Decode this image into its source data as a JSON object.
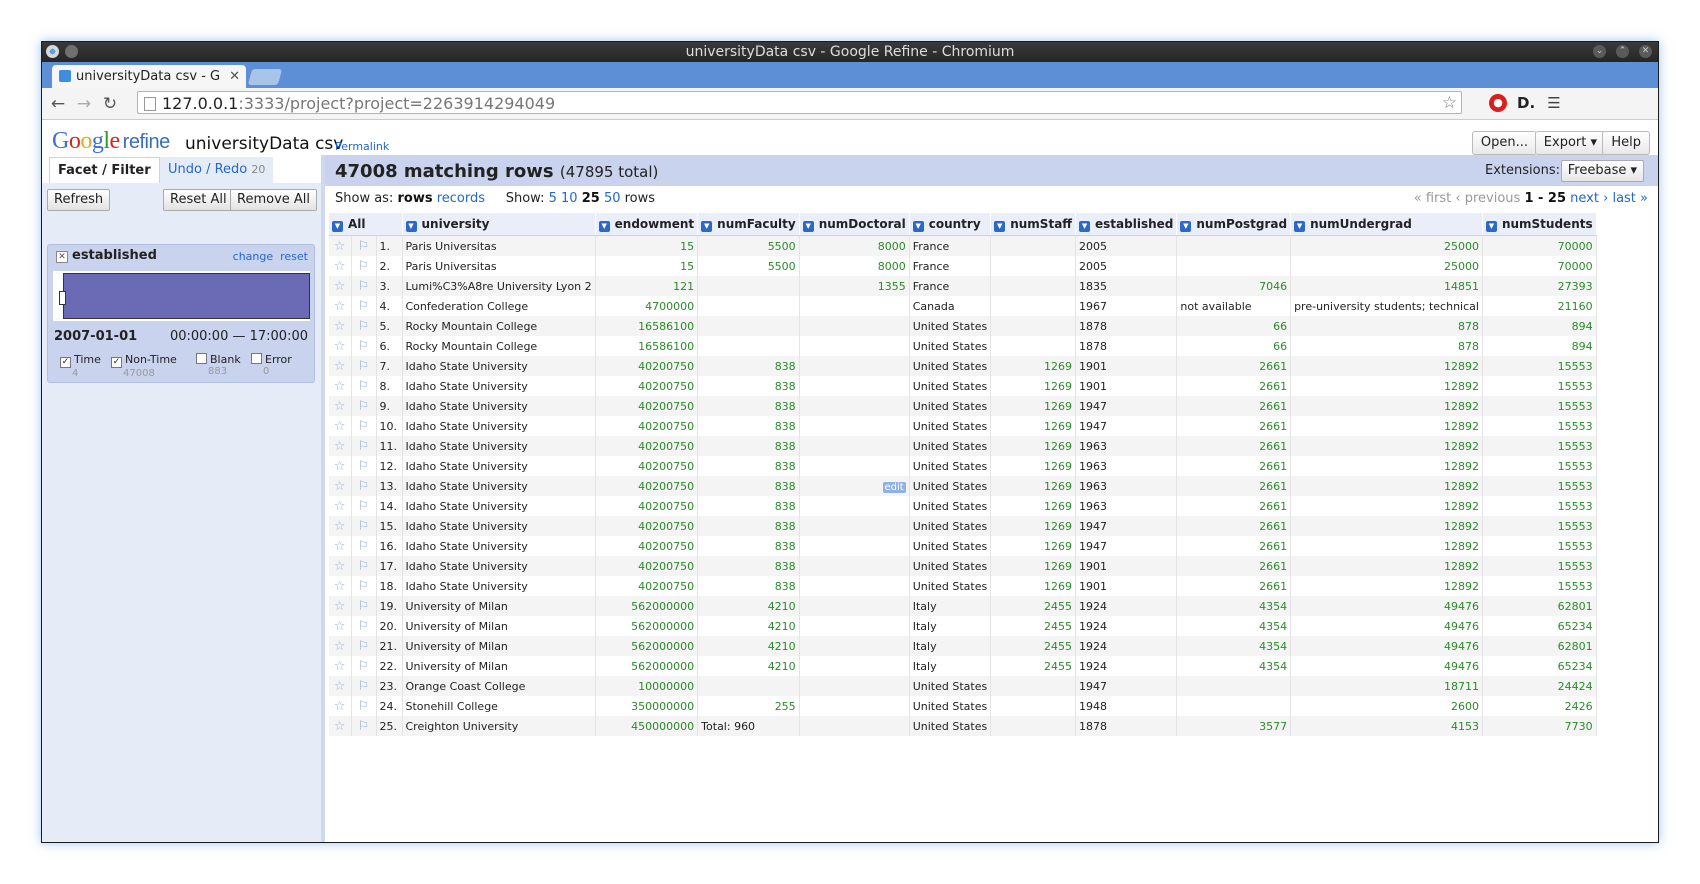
{
  "window": {
    "title": "universityData csv - Google Refine - Chromium"
  },
  "browser": {
    "tab_title": "universityData csv - G",
    "url_host": "127.0.0.1",
    "url_path": ":3333/project?project=2263914294049"
  },
  "header": {
    "logo_refine": "refine",
    "project_name": "universityData csv",
    "permalink": "Permalink",
    "open_label": "Open...",
    "export_label": "Export ▾",
    "help_label": "Help"
  },
  "leftpanel": {
    "tab_facet": "Facet / Filter",
    "tab_undo": "Undo / Redo",
    "undo_count": "20",
    "refresh": "Refresh",
    "reset_all": "Reset All",
    "remove_all": "Remove All",
    "facet": {
      "title": "established",
      "change": "change",
      "reset": "reset",
      "date": "2007-01-01",
      "time_range": "00:00:00 — 17:00:00",
      "checks": [
        {
          "label": "Time",
          "count": "4",
          "checked": true
        },
        {
          "label": "Non-Time",
          "count": "47008",
          "checked": true
        },
        {
          "label": "Blank",
          "count": "883",
          "checked": false
        },
        {
          "label": "Error",
          "count": "0",
          "checked": false
        }
      ]
    }
  },
  "summary": {
    "matching": "47008 matching rows",
    "total": "(47895 total)",
    "extensions_label": "Extensions:",
    "extensions_btn": "Freebase ▾"
  },
  "viewbar": {
    "show_as": "Show as:",
    "rows": "rows",
    "records": "records",
    "show": "Show:",
    "opt5": "5",
    "opt10": "10",
    "opt25": "25",
    "opt50": "50",
    "rows_suffix": "rows",
    "first": "« first",
    "previous": "‹ previous",
    "range": "1 - 25",
    "next": "next ›",
    "last": "last »"
  },
  "table": {
    "all_label": "All",
    "columns": [
      "university",
      "endowment",
      "numFaculty",
      "numDoctoral",
      "country",
      "numStaff",
      "established",
      "numPostgrad",
      "numUndergrad",
      "numStudents"
    ],
    "rows": [
      [
        "1.",
        "Paris Universitas",
        "15",
        "5500",
        "8000",
        "France",
        "",
        "2005",
        "",
        "25000",
        "70000"
      ],
      [
        "2.",
        "Paris Universitas",
        "15",
        "5500",
        "8000",
        "France",
        "",
        "2005",
        "",
        "25000",
        "70000"
      ],
      [
        "3.",
        "Lumi%C3%A8re University Lyon 2",
        "121",
        "",
        "1355",
        "France",
        "",
        "1835",
        "7046",
        "14851",
        "27393"
      ],
      [
        "4.",
        "Confederation College",
        "4700000",
        "",
        "",
        "Canada",
        "",
        "1967",
        "not available",
        "pre-university students; technical",
        "21160"
      ],
      [
        "5.",
        "Rocky Mountain College",
        "16586100",
        "",
        "",
        "United States",
        "",
        "1878",
        "66",
        "878",
        "894"
      ],
      [
        "6.",
        "Rocky Mountain College",
        "16586100",
        "",
        "",
        "United States",
        "",
        "1878",
        "66",
        "878",
        "894"
      ],
      [
        "7.",
        "Idaho State University",
        "40200750",
        "838",
        "",
        "United States",
        "1269",
        "1901",
        "2661",
        "12892",
        "15553"
      ],
      [
        "8.",
        "Idaho State University",
        "40200750",
        "838",
        "",
        "United States",
        "1269",
        "1901",
        "2661",
        "12892",
        "15553"
      ],
      [
        "9.",
        "Idaho State University",
        "40200750",
        "838",
        "",
        "United States",
        "1269",
        "1947",
        "2661",
        "12892",
        "15553"
      ],
      [
        "10.",
        "Idaho State University",
        "40200750",
        "838",
        "",
        "United States",
        "1269",
        "1947",
        "2661",
        "12892",
        "15553"
      ],
      [
        "11.",
        "Idaho State University",
        "40200750",
        "838",
        "",
        "United States",
        "1269",
        "1963",
        "2661",
        "12892",
        "15553"
      ],
      [
        "12.",
        "Idaho State University",
        "40200750",
        "838",
        "",
        "United States",
        "1269",
        "1963",
        "2661",
        "12892",
        "15553"
      ],
      [
        "13.",
        "Idaho State University",
        "40200750",
        "838",
        "edit",
        "United States",
        "1269",
        "1963",
        "2661",
        "12892",
        "15553"
      ],
      [
        "14.",
        "Idaho State University",
        "40200750",
        "838",
        "",
        "United States",
        "1269",
        "1963",
        "2661",
        "12892",
        "15553"
      ],
      [
        "15.",
        "Idaho State University",
        "40200750",
        "838",
        "",
        "United States",
        "1269",
        "1947",
        "2661",
        "12892",
        "15553"
      ],
      [
        "16.",
        "Idaho State University",
        "40200750",
        "838",
        "",
        "United States",
        "1269",
        "1947",
        "2661",
        "12892",
        "15553"
      ],
      [
        "17.",
        "Idaho State University",
        "40200750",
        "838",
        "",
        "United States",
        "1269",
        "1901",
        "2661",
        "12892",
        "15553"
      ],
      [
        "18.",
        "Idaho State University",
        "40200750",
        "838",
        "",
        "United States",
        "1269",
        "1901",
        "2661",
        "12892",
        "15553"
      ],
      [
        "19.",
        "University of Milan",
        "562000000",
        "4210",
        "",
        "Italy",
        "2455",
        "1924",
        "4354",
        "49476",
        "62801"
      ],
      [
        "20.",
        "University of Milan",
        "562000000",
        "4210",
        "",
        "Italy",
        "2455",
        "1924",
        "4354",
        "49476",
        "65234"
      ],
      [
        "21.",
        "University of Milan",
        "562000000",
        "4210",
        "",
        "Italy",
        "2455",
        "1924",
        "4354",
        "49476",
        "62801"
      ],
      [
        "22.",
        "University of Milan",
        "562000000",
        "4210",
        "",
        "Italy",
        "2455",
        "1924",
        "4354",
        "49476",
        "65234"
      ],
      [
        "23.",
        "Orange Coast College",
        "10000000",
        "",
        "",
        "United States",
        "",
        "1947",
        "",
        "18711",
        "24424"
      ],
      [
        "24.",
        "Stonehill College",
        "350000000",
        "255",
        "",
        "United States",
        "",
        "1948",
        "",
        "2600",
        "2426"
      ],
      [
        "25.",
        "Creighton University",
        "450000000",
        "Total: 960",
        "",
        "United States",
        "",
        "1878",
        "3577",
        "4153",
        "7730"
      ]
    ]
  }
}
